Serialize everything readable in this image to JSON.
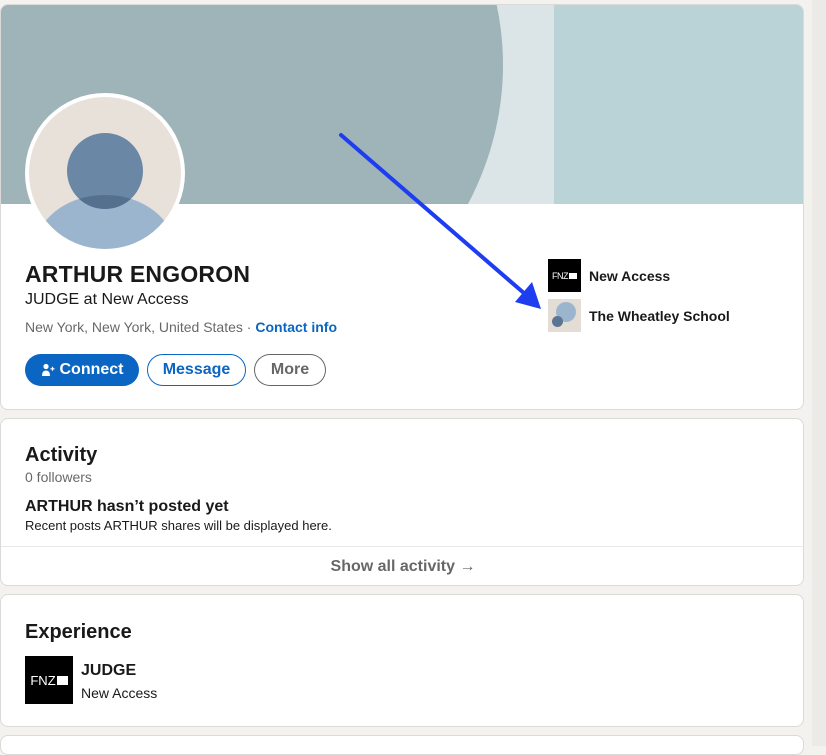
{
  "profile": {
    "name": "ARTHUR ENGORON",
    "headline": "JUDGE at New Access",
    "location": "New York, New York, United States",
    "separator": "·",
    "contact_label": "Contact info",
    "buttons": {
      "connect": "Connect",
      "message": "Message",
      "more": "More"
    },
    "organizations": [
      {
        "name": "New Access",
        "logo_text": "FNZ",
        "icon": "fnz-logo"
      },
      {
        "name": "The Wheatley School",
        "icon": "school-logo"
      }
    ]
  },
  "activity": {
    "title": "Activity",
    "followers": "0 followers",
    "empty_title": "ARTHUR hasn’t posted yet",
    "empty_subtitle": "Recent posts ARTHUR shares will be displayed here.",
    "show_all": "Show all activity →"
  },
  "experience": {
    "title": "Experience",
    "items": [
      {
        "role": "JUDGE",
        "organization": "New Access",
        "logo_text": "FNZ"
      }
    ]
  },
  "colors": {
    "accent": "#0a66c2",
    "annotation_arrow": "#1f3df0",
    "banner_left": "#9fb4b8",
    "banner_right": "#b9d3d6"
  }
}
